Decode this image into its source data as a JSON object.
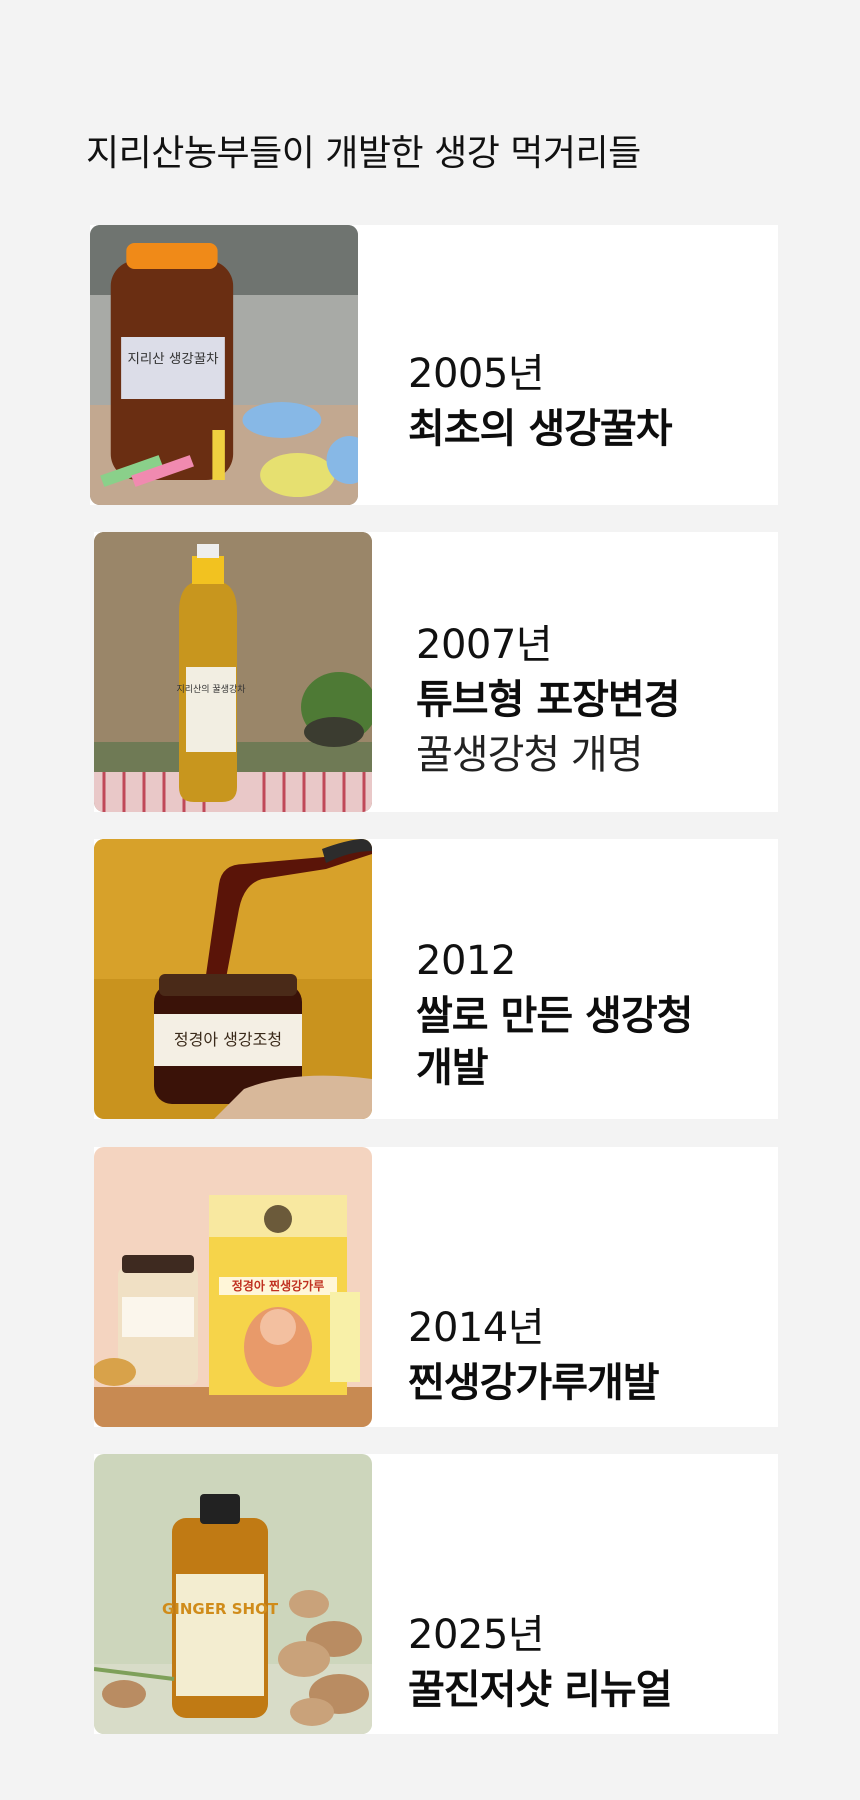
{
  "page": {
    "title": "지리산농부들이 개발한 생강 먹거리들"
  },
  "timeline": [
    {
      "year": "2005년",
      "headline": "최초의 생강꿀차",
      "sub": "",
      "image": "honey-ginger-tea-jar-photo",
      "label": "지리산 생강꿀차"
    },
    {
      "year": "2007년",
      "headline": "튜브형 포장변경",
      "sub": "꿀생강청 개명",
      "image": "tube-bottle-photo",
      "label": "지리산의 꿀생강차"
    },
    {
      "year": "2012",
      "headline": "쌀로 만든 생강청 개발",
      "sub": "",
      "image": "rice-ginger-syrup-photo",
      "label": "정경아 생강조청"
    },
    {
      "year": "2014년",
      "headline": "찐생강가루개발",
      "sub": "",
      "image": "steamed-ginger-powder-photo",
      "label": "정경아 찐생강가루"
    },
    {
      "year": "2025년",
      "headline": "꿀진저샷 리뉴얼",
      "sub": "",
      "image": "ginger-shot-bottle-photo",
      "label": "GINGER SHOT"
    }
  ]
}
